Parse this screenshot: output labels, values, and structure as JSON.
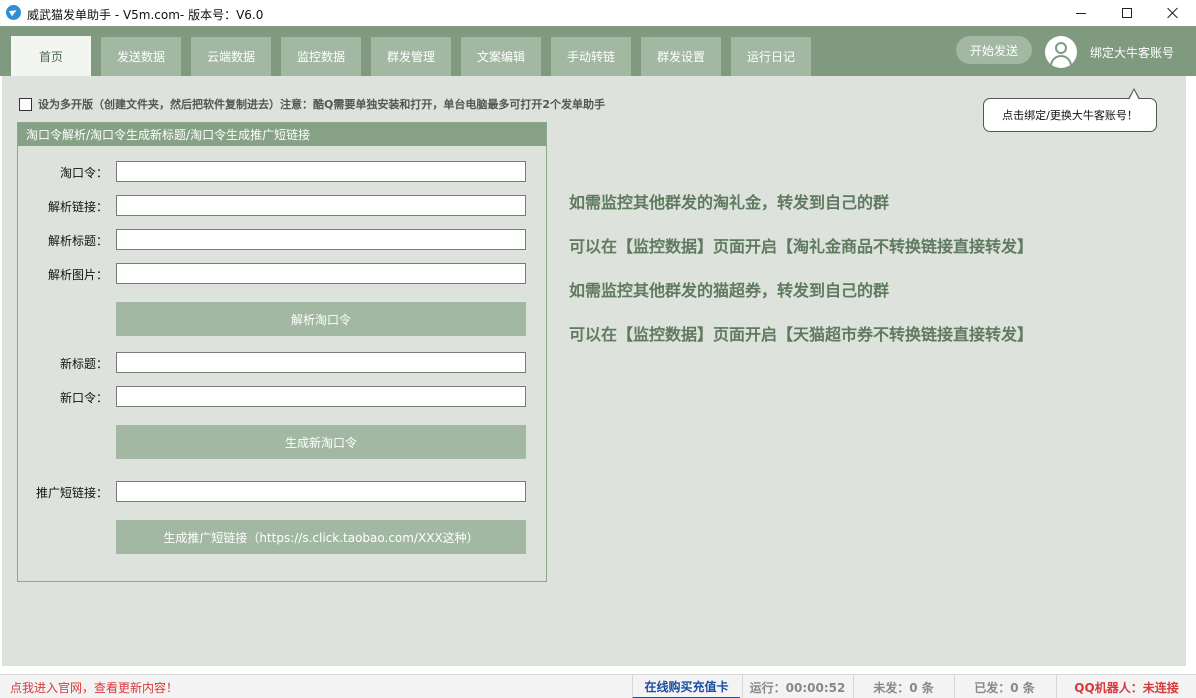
{
  "window": {
    "title": "威武猫发单助手 - V5m.com- 版本号：V6.0"
  },
  "header": {
    "tabs": [
      {
        "label": "首页",
        "active": true
      },
      {
        "label": "发送数据",
        "active": false
      },
      {
        "label": "云端数据",
        "active": false
      },
      {
        "label": "监控数据",
        "active": false
      },
      {
        "label": "群发管理",
        "active": false
      },
      {
        "label": "文案编辑",
        "active": false
      },
      {
        "label": "手动转链",
        "active": false
      },
      {
        "label": "群发设置",
        "active": false
      },
      {
        "label": "运行日记",
        "active": false
      }
    ],
    "start_button": "开始发送",
    "bind_account_label": "绑定大牛客账号"
  },
  "tooltip": {
    "text": "点击绑定/更换大牛客账号！"
  },
  "options": {
    "multi_open_checked": false,
    "multi_open_text": "设为多开版（创建文件夹，然后把软件复制进去）注意：酷Q需要单独安装和打开，单台电脑最多可打开2个发单助手"
  },
  "panel": {
    "title": "淘口令解析/淘口令生成新标题/淘口令生成推广短链接",
    "fields": {
      "tkl_label": "淘口令：",
      "tkl_value": "",
      "link_label": "解析链接：",
      "link_value": "",
      "title_label": "解析标题：",
      "title_value": "",
      "image_label": "解析图片：",
      "image_value": "",
      "new_title_label": "新标题：",
      "new_title_value": "",
      "new_tkl_label": "新口令：",
      "new_tkl_value": "",
      "short_link_label": "推广短链接：",
      "short_link_value": ""
    },
    "buttons": {
      "parse": "解析淘口令",
      "generate_tkl": "生成新淘口令",
      "generate_short": "生成推广短链接（https://s.click.taobao.com/XXX这种）"
    }
  },
  "info": {
    "lines": [
      "如需监控其他群发的淘礼金，转发到自己的群",
      "可以在【监控数据】页面开启【淘礼金商品不转换链接直接转发】",
      "如需监控其他群发的猫超券，转发到自己的群",
      "可以在【监控数据】页面开启【天猫超市券不转换链接直接转发】"
    ]
  },
  "status": {
    "site_link": "点我进入官网，查看更新内容！",
    "buy_card": "在线购买充值卡",
    "running": "运行：00:00:52",
    "unsent": "未发：0 条",
    "sent": "已发：0 条",
    "qq_robot": "QQ机器人：未连接"
  },
  "colors": {
    "header_green": "#7f9a7f",
    "tab_green": "#a3b8a3",
    "body_bg": "#dde3dc",
    "info_text": "#5f7a5f",
    "status_red": "#d83a3a",
    "status_blue": "#1d4fa0"
  },
  "icons": {
    "app": "telegram-plane-icon",
    "avatar": "user-avatar-icon"
  }
}
